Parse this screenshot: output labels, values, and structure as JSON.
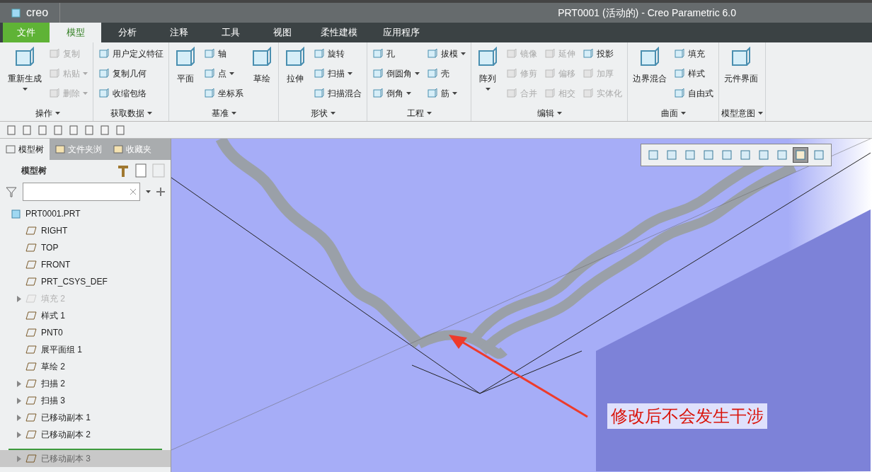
{
  "window": {
    "logo": "creo",
    "title": "PRT0001 (活动的) - Creo Parametric 6.0"
  },
  "menu_tabs": [
    {
      "label": "文件",
      "kind": "file"
    },
    {
      "label": "模型",
      "kind": "tab",
      "selected": true
    },
    {
      "label": "分析",
      "kind": "tab",
      "selected": false
    },
    {
      "label": "注释",
      "kind": "tab",
      "selected": false
    },
    {
      "label": "工具",
      "kind": "tab",
      "selected": false
    },
    {
      "label": "视图",
      "kind": "tab",
      "selected": false
    },
    {
      "label": "柔性建模",
      "kind": "tab",
      "selected": false
    },
    {
      "label": "应用程序",
      "kind": "tab",
      "selected": false
    }
  ],
  "ribbon_groups": [
    {
      "label": "操作",
      "columns": [
        [
          {
            "label": "重新生成",
            "kind": "large",
            "disabled": false,
            "dropdown": true
          }
        ],
        [
          {
            "label": "复制",
            "kind": "small",
            "disabled": true,
            "dropdown": false
          },
          {
            "label": "粘贴",
            "kind": "small",
            "disabled": true,
            "dropdown": true
          },
          {
            "label": "删除",
            "kind": "small",
            "disabled": true,
            "dropdown": true
          }
        ]
      ]
    },
    {
      "label": "获取数据",
      "columns": [
        [
          {
            "label": "用户定义特征",
            "kind": "small",
            "disabled": false,
            "dropdown": false
          },
          {
            "label": "复制几何",
            "kind": "small",
            "disabled": false,
            "dropdown": false
          },
          {
            "label": "收缩包络",
            "kind": "small",
            "disabled": false,
            "dropdown": false
          }
        ]
      ]
    },
    {
      "label": "基准",
      "columns": [
        [
          {
            "label": "平面",
            "kind": "large",
            "disabled": false,
            "dropdown": false
          }
        ],
        [
          {
            "label": "轴",
            "kind": "small",
            "disabled": false,
            "dropdown": false
          },
          {
            "label": "点",
            "kind": "small",
            "disabled": false,
            "dropdown": true
          },
          {
            "label": "坐标系",
            "kind": "small",
            "disabled": false,
            "dropdown": false
          }
        ],
        [
          {
            "label": "草绘",
            "kind": "large",
            "disabled": false,
            "dropdown": false
          }
        ]
      ]
    },
    {
      "label": "形状",
      "columns": [
        [
          {
            "label": "拉伸",
            "kind": "large",
            "disabled": false,
            "dropdown": false
          }
        ],
        [
          {
            "label": "旋转",
            "kind": "small",
            "disabled": false,
            "dropdown": false
          },
          {
            "label": "扫描",
            "kind": "small",
            "disabled": false,
            "dropdown": true
          },
          {
            "label": "扫描混合",
            "kind": "small",
            "disabled": false,
            "dropdown": false
          }
        ]
      ]
    },
    {
      "label": "工程",
      "columns": [
        [
          {
            "label": "孔",
            "kind": "small",
            "disabled": false,
            "dropdown": false
          },
          {
            "label": "倒圆角",
            "kind": "small",
            "disabled": false,
            "dropdown": true
          },
          {
            "label": "倒角",
            "kind": "small",
            "disabled": false,
            "dropdown": true
          }
        ],
        [
          {
            "label": "拔模",
            "kind": "small",
            "disabled": false,
            "dropdown": true
          },
          {
            "label": "壳",
            "kind": "small",
            "disabled": false,
            "dropdown": false
          },
          {
            "label": "筋",
            "kind": "small",
            "disabled": false,
            "dropdown": true
          }
        ]
      ]
    },
    {
      "label": "编辑",
      "columns": [
        [
          {
            "label": "阵列",
            "kind": "large",
            "disabled": false,
            "dropdown": true
          }
        ],
        [
          {
            "label": "镜像",
            "kind": "small",
            "disabled": true,
            "dropdown": false
          },
          {
            "label": "修剪",
            "kind": "small",
            "disabled": true,
            "dropdown": false
          },
          {
            "label": "合并",
            "kind": "small",
            "disabled": true,
            "dropdown": false
          }
        ],
        [
          {
            "label": "延伸",
            "kind": "small",
            "disabled": true,
            "dropdown": false
          },
          {
            "label": "偏移",
            "kind": "small",
            "disabled": true,
            "dropdown": false
          },
          {
            "label": "相交",
            "kind": "small",
            "disabled": true,
            "dropdown": false
          }
        ],
        [
          {
            "label": "投影",
            "kind": "small",
            "disabled": false,
            "dropdown": false
          },
          {
            "label": "加厚",
            "kind": "small",
            "disabled": true,
            "dropdown": false
          },
          {
            "label": "实体化",
            "kind": "small",
            "disabled": true,
            "dropdown": false
          }
        ]
      ]
    },
    {
      "label": "曲面",
      "columns": [
        [
          {
            "label": "边界混合",
            "kind": "large",
            "disabled": false,
            "dropdown": false
          }
        ],
        [
          {
            "label": "填充",
            "kind": "small",
            "disabled": false,
            "dropdown": false
          },
          {
            "label": "样式",
            "kind": "small",
            "disabled": false,
            "dropdown": false
          },
          {
            "label": "自由式",
            "kind": "small",
            "disabled": false,
            "dropdown": false
          }
        ]
      ]
    },
    {
      "label": "模型意图",
      "columns": [
        [
          {
            "label": "元件界面",
            "kind": "large",
            "disabled": false,
            "dropdown": false
          }
        ]
      ]
    }
  ],
  "panel_tabs": [
    {
      "label": "模型树",
      "selected": true
    },
    {
      "label": "文件夹浏",
      "selected": false
    },
    {
      "label": "收藏夹",
      "selected": false
    }
  ],
  "tree_title": "模型树",
  "tree": {
    "label": "PRT0001.PRT",
    "children": [
      {
        "label": "RIGHT",
        "disabled": false,
        "expandable": false,
        "selected": false
      },
      {
        "label": "TOP",
        "disabled": false,
        "expandable": false,
        "selected": false
      },
      {
        "label": "FRONT",
        "disabled": false,
        "expandable": false,
        "selected": false
      },
      {
        "label": "PRT_CSYS_DEF",
        "disabled": false,
        "expandable": false,
        "selected": false
      },
      {
        "label": "填充 2",
        "disabled": true,
        "expandable": true,
        "selected": false
      },
      {
        "label": "样式 1",
        "disabled": false,
        "expandable": false,
        "selected": false
      },
      {
        "label": "PNT0",
        "disabled": false,
        "expandable": false,
        "selected": false
      },
      {
        "label": "展平面组 1",
        "disabled": false,
        "expandable": false,
        "selected": false
      },
      {
        "label": "草绘 2",
        "disabled": false,
        "expandable": false,
        "selected": false
      },
      {
        "label": "扫描 2",
        "disabled": false,
        "expandable": true,
        "selected": false
      },
      {
        "label": "扫描 3",
        "disabled": false,
        "expandable": true,
        "selected": false
      },
      {
        "label": "已移动副本 1",
        "disabled": false,
        "expandable": true,
        "selected": false
      },
      {
        "label": "已移动副本 2",
        "disabled": false,
        "expandable": true,
        "selected": false
      },
      {
        "label": "已移动副本 3",
        "disabled": false,
        "expandable": true,
        "selected": true
      }
    ]
  },
  "view_toolbar": [
    {
      "selected": false
    },
    {
      "selected": false
    },
    {
      "selected": false
    },
    {
      "selected": false
    },
    {
      "selected": false
    },
    {
      "selected": false
    },
    {
      "selected": false
    },
    {
      "selected": false
    },
    {
      "selected": true
    },
    {
      "selected": false
    }
  ],
  "annotation": "修改后不会发生干涉"
}
